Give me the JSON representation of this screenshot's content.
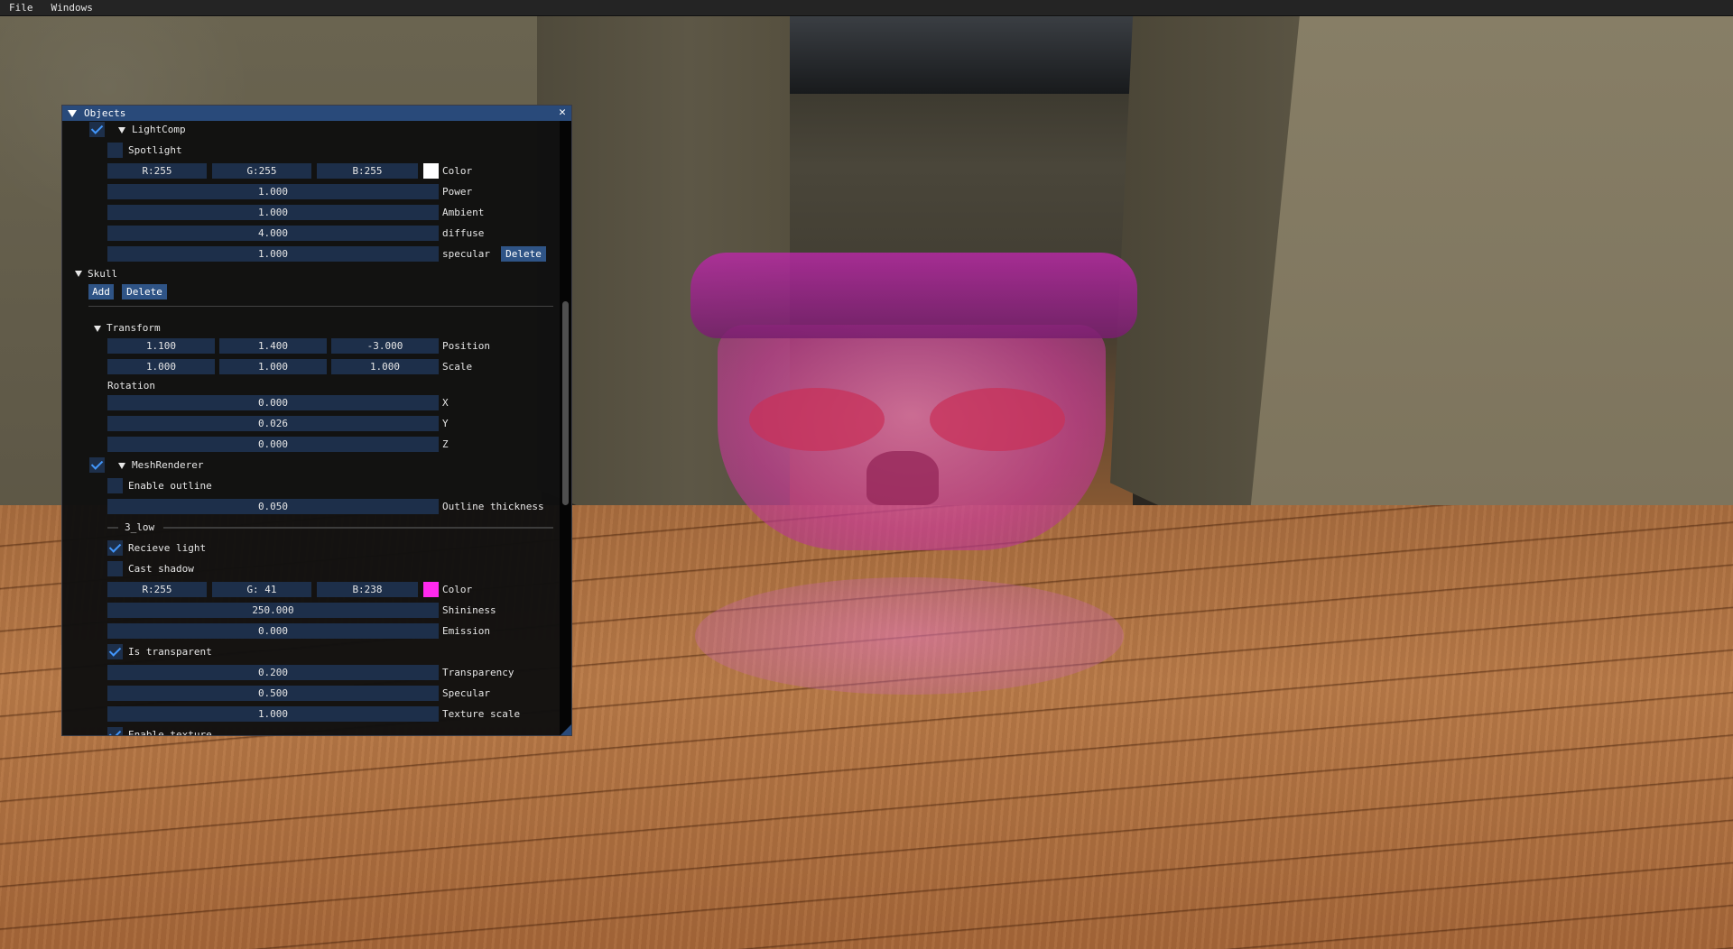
{
  "menubar": {
    "file": "File",
    "windows": "Windows"
  },
  "window": {
    "title": "Objects",
    "close": "✕"
  },
  "light": {
    "component": "LightComp",
    "spotlight": "Spotlight",
    "color": {
      "r": "R:255",
      "g": "G:255",
      "b": "B:255",
      "label": "Color",
      "swatch": "#ffffff"
    },
    "power": {
      "value": "1.000",
      "label": "Power"
    },
    "ambient": {
      "value": "1.000",
      "label": "Ambient"
    },
    "diffuse": {
      "value": "4.000",
      "label": "diffuse"
    },
    "specular": {
      "value": "1.000",
      "label": "specular"
    },
    "delete": "Delete"
  },
  "object": {
    "name": "Skull",
    "add": "Add",
    "delete": "Delete",
    "transform": {
      "header": "Transform",
      "position": {
        "x": "1.100",
        "y": "1.400",
        "z": "-3.000",
        "label": "Position"
      },
      "scale": {
        "x": "1.000",
        "y": "1.000",
        "z": "1.000",
        "label": "Scale"
      },
      "rotation_label": "Rotation",
      "rx": {
        "value": "0.000",
        "label": "X"
      },
      "ry": {
        "value": "0.026",
        "label": "Y"
      },
      "rz": {
        "value": "0.000",
        "label": "Z"
      }
    },
    "mesh": {
      "header": "MeshRenderer",
      "enable_outline": "Enable outline",
      "outline_thickness": {
        "value": "0.050",
        "label": "Outline thickness"
      },
      "submesh": "3_low",
      "recieve_light": "Recieve light",
      "cast_shadow": "Cast shadow",
      "color": {
        "r": "R:255",
        "g": "G: 41",
        "b": "B:238",
        "label": "Color",
        "swatch": "#ff29ee"
      },
      "shininess": {
        "value": "250.000",
        "label": "Shininess"
      },
      "emission": {
        "value": "0.000",
        "label": "Emission"
      },
      "is_transparent": "Is transparent",
      "transparency": {
        "value": "0.200",
        "label": "Transparency"
      },
      "specular": {
        "value": "0.500",
        "label": "Specular"
      },
      "texture_scale": {
        "value": "1.000",
        "label": "Texture scale"
      },
      "enable_texture": "Enable texture"
    }
  },
  "checkboxes": {
    "light_enabled": true,
    "spotlight": false,
    "mesh_enabled": true,
    "enable_outline": false,
    "recieve_light": true,
    "cast_shadow": false,
    "is_transparent": true,
    "enable_texture": true
  }
}
